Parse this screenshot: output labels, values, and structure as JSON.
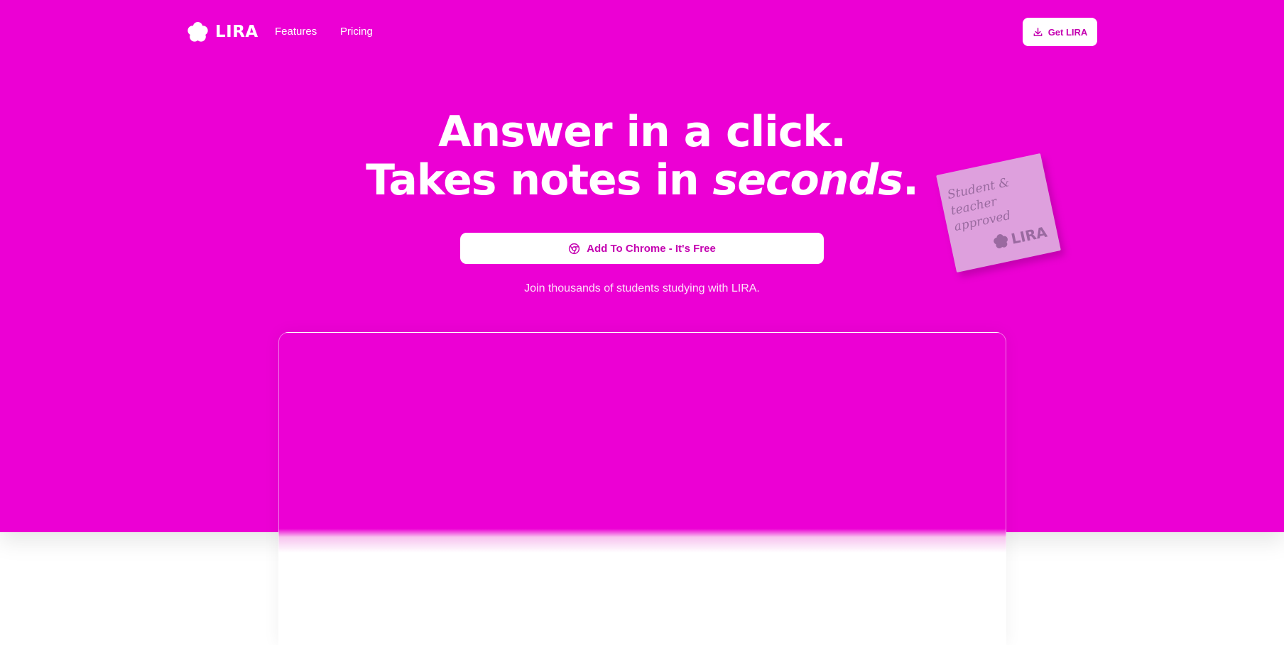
{
  "nav": {
    "logo_text": "LIRA",
    "links": [
      {
        "label": "Features"
      },
      {
        "label": "Pricing"
      }
    ],
    "get_button_label": "Get LIRA"
  },
  "hero": {
    "headline_line1": "Answer in a click.",
    "headline_line2_prefix": "Takes notes in ",
    "headline_line2_emphasis": "seconds",
    "headline_line2_suffix": ".",
    "cta_label": "Add To Chrome - It's Free",
    "subtext": "Join thousands of students studying with LIRA."
  },
  "sticky_note": {
    "text": "Student & teacher approved",
    "logo_text": "LIRA"
  },
  "colors": {
    "brand": "#ec00d4",
    "button_text": "#c400b0",
    "white": "#ffffff"
  },
  "icons": {
    "logo": "flower-icon",
    "get_button": "download-icon",
    "cta": "chrome-icon"
  }
}
